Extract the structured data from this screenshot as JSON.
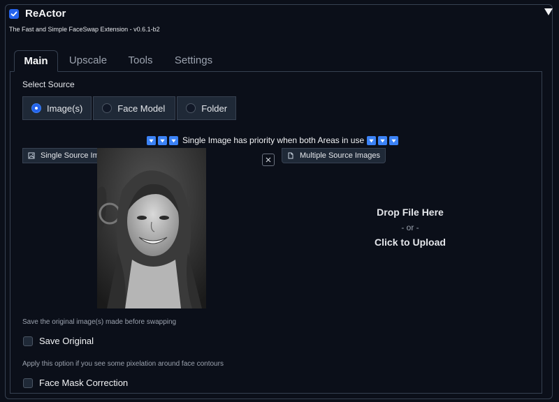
{
  "header": {
    "title": "ReActor",
    "enabled": true,
    "subtitle": "The Fast and Simple FaceSwap Extension - v0.6.1-b2"
  },
  "tabs": [
    {
      "label": "Main",
      "active": true
    },
    {
      "label": "Upscale",
      "active": false
    },
    {
      "label": "Tools",
      "active": false
    },
    {
      "label": "Settings",
      "active": false
    }
  ],
  "main": {
    "select_source_label": "Select Source",
    "source_options": [
      {
        "label": "Image(s)",
        "selected": true
      },
      {
        "label": "Face Model",
        "selected": false
      },
      {
        "label": "Folder",
        "selected": false
      }
    ],
    "priority_note": "Single Image has priority when both Areas in use",
    "single_source_label": "Single Source Image",
    "multiple_source_label": "Multiple Source Images",
    "drop_zone": {
      "line1": "Drop File Here",
      "line2": "- or -",
      "line3": "Click to Upload"
    },
    "save_original_hint": "Save the original image(s) made before swapping",
    "save_original_label": "Save Original",
    "save_original_checked": false,
    "face_mask_hint": "Apply this option if you see some pixelation around face contours",
    "face_mask_label": "Face Mask Correction",
    "face_mask_checked": false
  },
  "colors": {
    "background": "#0b0f19",
    "accent": "#2563eb",
    "border": "#374151"
  }
}
